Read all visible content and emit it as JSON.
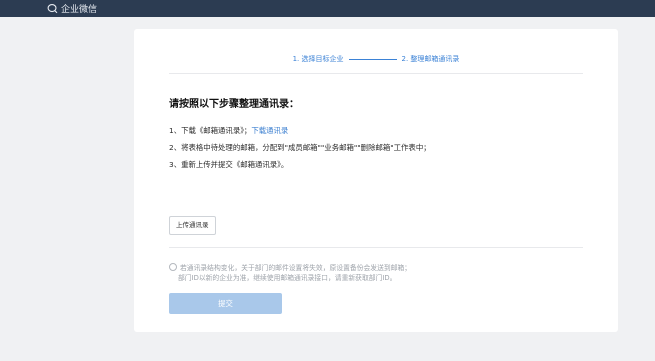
{
  "app": {
    "name": "企业微信"
  },
  "steps": {
    "step1": "1. 选择目标企业",
    "step2": "2. 整理邮箱通讯录"
  },
  "main": {
    "title": "请按照以下步骤整理通讯录：",
    "line1_prefix": "1、下载《邮箱通讯录》；",
    "line1_link": "下载通讯录",
    "line2": "2、将表格中待处理的邮箱，分配到\"成员邮箱\"\"业务邮箱\"\"删除邮箱\"工作表中；",
    "line3": "3、重新上传并提交《邮箱通讯录》。",
    "upload_label": "上传通讯录",
    "notice_line1": "若通讯录结构变化，关于部门的邮件设置将失效，原设置备份会发送到邮箱；",
    "notice_line2": "部门ID以新的企业为准，继续使用邮箱通讯录接口，请重新获取部门ID。",
    "submit_label": "提交"
  },
  "colors": {
    "topbar": "#2c3c52",
    "accent": "#3b82d6",
    "submit_disabled": "#a9c8ea"
  },
  "icons": {
    "brand": "wecom-logo-icon",
    "notice": "info-circle-icon"
  }
}
